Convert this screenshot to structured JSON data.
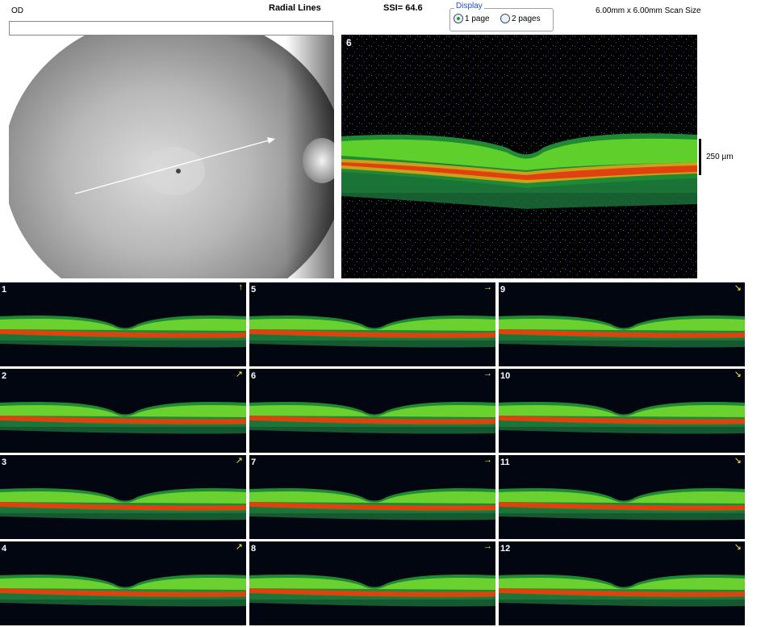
{
  "header": {
    "eye": "OD",
    "scan_mode": "Radial Lines",
    "ssi": "SSI= 64.6",
    "scan_size": "6.00mm x 6.00mm Scan Size"
  },
  "display": {
    "legend": "Display",
    "options": [
      "1 page",
      "2 pages"
    ],
    "selected": "1 page"
  },
  "main_scan": {
    "number": "6",
    "scale_label": "250 µm"
  },
  "scans": [
    {
      "number": "1",
      "arrow": "↑"
    },
    {
      "number": "5",
      "arrow": "→"
    },
    {
      "number": "9",
      "arrow": "↘"
    },
    {
      "number": "2",
      "arrow": "↗"
    },
    {
      "number": "6",
      "arrow": "→"
    },
    {
      "number": "10",
      "arrow": "↘"
    },
    {
      "number": "3",
      "arrow": "↗"
    },
    {
      "number": "7",
      "arrow": "→"
    },
    {
      "number": "11",
      "arrow": "↘"
    },
    {
      "number": "4",
      "arrow": "↗"
    },
    {
      "number": "8",
      "arrow": "→"
    },
    {
      "number": "12",
      "arrow": "↘"
    }
  ]
}
